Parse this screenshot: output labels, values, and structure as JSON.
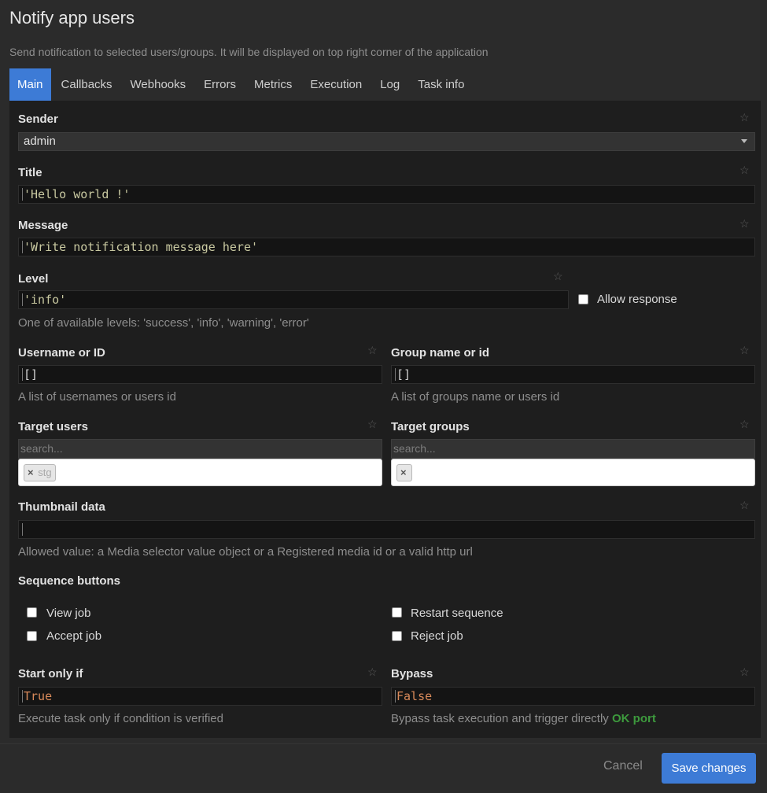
{
  "header": {
    "title": "Notify app users",
    "subtitle": "Send notification to selected users/groups. It will be displayed on top right corner of the application"
  },
  "tabs": [
    "Main",
    "Callbacks",
    "Webhooks",
    "Errors",
    "Metrics",
    "Execution",
    "Log",
    "Task info"
  ],
  "active_tab": "Main",
  "form": {
    "sender": {
      "label": "Sender",
      "value": "admin"
    },
    "title": {
      "label": "Title",
      "value": "'Hello world !'"
    },
    "message": {
      "label": "Message",
      "value": "'Write notification message here'"
    },
    "level": {
      "label": "Level",
      "value": "'info'",
      "help": "One of available levels: 'success', 'info', 'warning', 'error'"
    },
    "allow_response": {
      "label": "Allow response",
      "checked": false
    },
    "username": {
      "label": "Username or ID",
      "value": "[]",
      "help": "A list of usernames or users id"
    },
    "group": {
      "label": "Group name or id",
      "value": "[]",
      "help": "A list of groups name or users id"
    },
    "target_users": {
      "label": "Target users",
      "placeholder": "search...",
      "chip_remove": "×",
      "chip_text": "stg"
    },
    "target_groups": {
      "label": "Target groups",
      "placeholder": "search...",
      "chip_remove": "×"
    },
    "thumbnail": {
      "label": "Thumbnail data",
      "value": "",
      "help": "Allowed value: a Media selector value object or a Registered media id or a valid http url"
    },
    "sequence": {
      "label": "Sequence buttons",
      "options": [
        {
          "label": "View job",
          "checked": false
        },
        {
          "label": "Restart sequence",
          "checked": false
        },
        {
          "label": "Accept job",
          "checked": false
        },
        {
          "label": "Reject job",
          "checked": false
        }
      ]
    },
    "start_only_if": {
      "label": "Start only if",
      "value": "True",
      "help": "Execute task only if condition is verified"
    },
    "bypass": {
      "label": "Bypass",
      "value": "False",
      "help": "Bypass task execution and trigger directly",
      "help_highlight": "OK port"
    }
  },
  "footer": {
    "cancel": "Cancel",
    "save": "Save changes"
  },
  "colors": {
    "accent": "#3d7bd6",
    "ok_port": "#3d9a3d",
    "bool_literal": "#d98a5a"
  },
  "icons": {
    "field_star": "star-outline",
    "select_caret": "caret-down"
  }
}
